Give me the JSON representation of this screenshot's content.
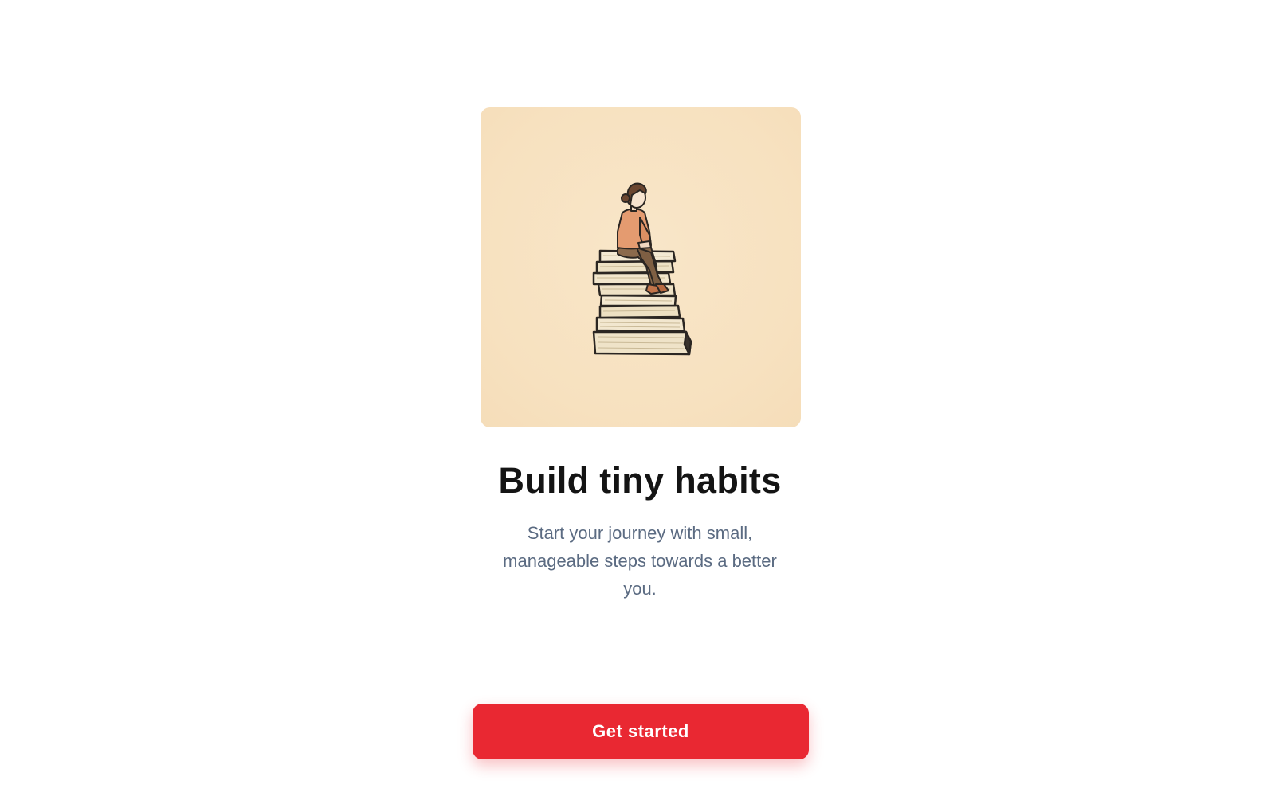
{
  "onboarding": {
    "illustration_icon": "person-on-book-stack-illustration",
    "title": "Build tiny habits",
    "subtitle": "Start your journey with small, manageable steps towards a better you.",
    "cta_label": "Get started"
  },
  "colors": {
    "accent": "#e92832",
    "illustration_background": "#f7e1bf",
    "title_text": "#141414",
    "subtitle_text": "#5b6b82"
  }
}
